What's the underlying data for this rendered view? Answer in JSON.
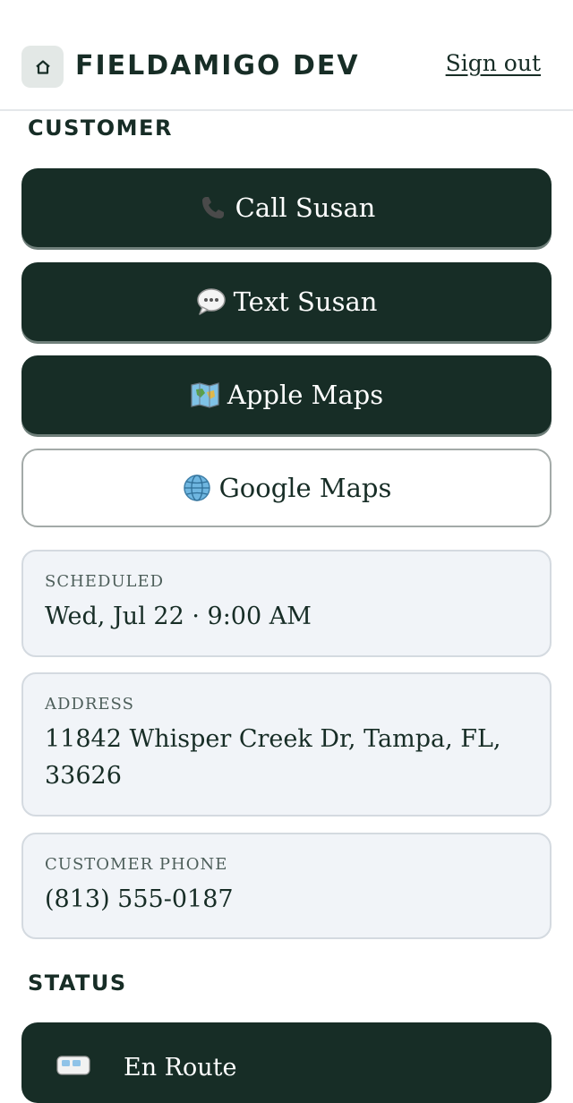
{
  "header": {
    "home_icon": "home-icon",
    "brand": "FIELDAMIGO DEV",
    "sign_out": "Sign out"
  },
  "customer": {
    "heading": "CUSTOMER",
    "actions": [
      {
        "label": "Call Susan",
        "icon": "phone-icon"
      },
      {
        "label": "Text Susan",
        "icon": "speech-bubble-icon"
      },
      {
        "label": "Apple Maps",
        "icon": "map-icon"
      },
      {
        "label": "Google Maps",
        "icon": "globe-icon"
      }
    ]
  },
  "details": {
    "scheduled_label": "SCHEDULED",
    "scheduled_value": "Wed, Jul 22 · 9:00 AM",
    "address_label": "ADDRESS",
    "address_value": "11842 Whisper Creek Dr, Tampa, FL, 33626",
    "phone_label": "CUSTOMER PHONE",
    "phone_value": "(813) 555-0187"
  },
  "status": {
    "heading": "STATUS",
    "current": "En Route",
    "icon": "van-icon"
  },
  "colors": {
    "primary": "#172d26",
    "card_bg": "#f1f4f8",
    "card_border": "#d4dae0",
    "muted_text": "#4d5e5a"
  }
}
